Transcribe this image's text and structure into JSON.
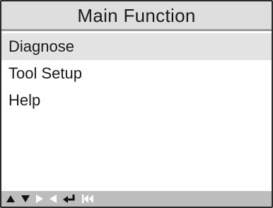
{
  "title": "Main Function",
  "menu": {
    "items": [
      {
        "label": "Diagnose",
        "selected": true
      },
      {
        "label": "Tool Setup",
        "selected": false
      },
      {
        "label": "Help",
        "selected": false
      }
    ]
  },
  "toolbar": {
    "buttons": [
      {
        "icon": "arrow-up-icon",
        "enabled": true
      },
      {
        "icon": "arrow-down-icon",
        "enabled": true
      },
      {
        "icon": "arrow-right-icon",
        "enabled": false
      },
      {
        "icon": "arrow-left-icon",
        "enabled": false
      },
      {
        "icon": "enter-icon",
        "enabled": true
      },
      {
        "icon": "skip-back-icon",
        "enabled": false
      }
    ]
  },
  "colors": {
    "titlebar_bg": "#dedede",
    "selected_row_bg": "#e3e3e3",
    "toolbar_bg": "#bdbdbd",
    "icon_enabled": "#111111",
    "icon_disabled": "#ffffff"
  }
}
